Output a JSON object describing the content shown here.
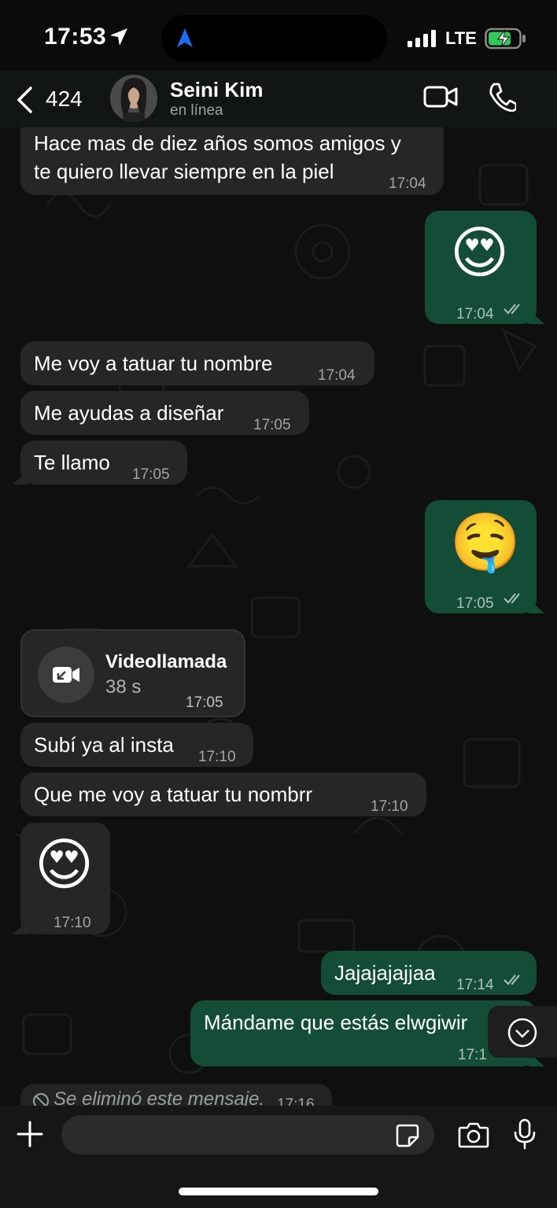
{
  "status_bar": {
    "time": "17:53",
    "network": "LTE"
  },
  "header": {
    "back_count": "424",
    "contact_name": "Seini Kim",
    "presence": "en línea"
  },
  "messages": [
    {
      "dir": "in",
      "text_lines": [
        "Hace mas de diez años somos amigos y",
        "te quiero llevar siempre en la piel"
      ],
      "time": "17:04"
    },
    {
      "dir": "out",
      "emoji": "😍",
      "time": "17:04"
    },
    {
      "dir": "in",
      "text": "Me voy a tatuar tu nombre",
      "time": "17:04"
    },
    {
      "dir": "in",
      "text": "Me ayudas a diseñar",
      "time": "17:05"
    },
    {
      "dir": "in",
      "text": "Te llamo",
      "time": "17:05"
    },
    {
      "dir": "out",
      "emoji": "🤤",
      "time": "17:05"
    },
    {
      "dir": "in",
      "type": "video_call",
      "title": "Videollamada",
      "duration": "38 s",
      "time": "17:05"
    },
    {
      "dir": "in",
      "text": "Subí ya al insta",
      "time": "17:10"
    },
    {
      "dir": "in",
      "text": "Que me voy a tatuar tu nombrr",
      "time": "17:10"
    },
    {
      "dir": "in",
      "emoji": "😍",
      "time": "17:10"
    },
    {
      "dir": "out",
      "text": "Jajajajajjaa",
      "time": "17:14"
    },
    {
      "dir": "out",
      "text": "Mándame que estás elwgiwir",
      "time": "17:1"
    },
    {
      "dir": "in",
      "type": "deleted",
      "text": "Se eliminó este mensaje.",
      "time": "17:16"
    }
  ],
  "icons": [
    "back-chevron-icon",
    "location-arrow-icon",
    "video-camera-icon",
    "phone-icon",
    "plus-icon",
    "sticker-icon",
    "camera-icon",
    "microphone-icon",
    "chevron-down-icon",
    "double-check-icon",
    "deleted-icon"
  ],
  "colors": {
    "incoming_bubble": "#262626",
    "outgoing_bubble": "#144d37",
    "battery_charging": "#34c759"
  }
}
